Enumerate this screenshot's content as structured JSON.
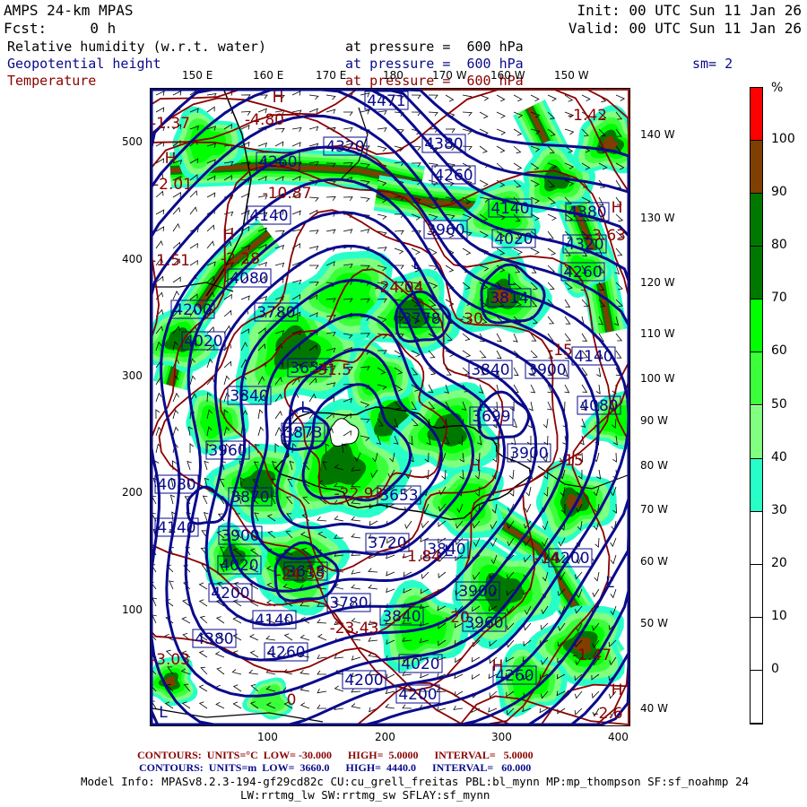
{
  "header": {
    "title": "AMPS 24-km MPAS",
    "fcst": "Fcst:     0 h",
    "init": "Init: 00 UTC Sun 11 Jan 26",
    "valid": "Valid: 00 UTC Sun 11 Jan 26",
    "fields": [
      {
        "name": "Relative humidity (w.r.t. water)",
        "level": "at pressure =  600 hPa",
        "color": "#000000"
      },
      {
        "name": "Geopotential height",
        "level": "at pressure =  600 hPa",
        "color": "#0a0a8c"
      },
      {
        "name": "Temperature",
        "level": "at pressure =  600 hPa",
        "color": "#8b0000"
      }
    ],
    "smoothing": "sm= 2"
  },
  "axes": {
    "top_lon_labels": [
      "150 E",
      "160 E",
      "170 E",
      "180",
      "170 W",
      "160 W",
      "150 W"
    ],
    "right_lon_labels": [
      "140 W",
      "130 W",
      "120 W",
      "110 W",
      "100 W",
      "90 W",
      "80 W",
      "70 W",
      "60 W",
      "50 W",
      "40 W"
    ],
    "left_ticks": [
      "500",
      "400",
      "300",
      "200",
      "100"
    ],
    "bottom_ticks": [
      "100",
      "200",
      "300",
      "400"
    ]
  },
  "colorbar": {
    "unit": "%",
    "labels": [
      "100",
      "90",
      "80",
      "70",
      "60",
      "50",
      "40",
      "30",
      "20",
      "10",
      "0"
    ],
    "colors": [
      "#ff0000",
      "#7f3f00",
      "#007800",
      "#007800",
      "#00ff00",
      "#3cff3c",
      "#80ff80",
      "#28ffc8",
      "#ffffff",
      "#ffffff",
      "#ffffff",
      "#ffffff"
    ]
  },
  "map": {
    "height_contour_color": "#0a0a8c",
    "temperature_contour_color": "#8b0000",
    "height_labels": [
      "4471",
      "4320",
      "4380",
      "4260",
      "4260",
      "4140",
      "4140",
      "3960",
      "4020",
      "4380",
      "4320",
      "4260",
      "3814",
      "3778",
      "4080",
      "4200",
      "3780",
      "4020",
      "3654",
      "3840",
      "4140",
      "3840",
      "3900",
      "4080",
      "3699",
      "3900",
      "3873",
      "3960",
      "4080",
      "3870",
      "4140",
      "3900",
      "4020",
      "3618",
      "4200",
      "4140",
      "4380",
      "4260",
      "4200",
      "3780",
      "3720",
      "3840",
      "3900",
      "3840",
      "3960",
      "4020",
      "4200",
      "4260",
      "4200",
      "3653"
    ],
    "temperature_labels": [
      "-4.80",
      "-1.37",
      "-2.01",
      "-10.87",
      "-2.28",
      "-1.51",
      "-31.5",
      "-24.04",
      "-1.42",
      "-3.63",
      "-15",
      "-30",
      "-22.93",
      "-24.35",
      "-23.43",
      "-3.03",
      "0",
      "-1.47",
      "-2.6",
      "-20",
      "-14",
      "-15",
      "-1.84"
    ],
    "high_markers": [
      "H",
      "H",
      "H",
      "H",
      "H",
      "H",
      "H"
    ],
    "low_markers": [
      "L",
      "L",
      "L",
      "L",
      "L",
      "L"
    ]
  },
  "footer": {
    "temp_contours": "CONTOURS:  UNITS=°C  LOW= -30.000      HIGH=  5.0000      INTERVAL=   5.0000",
    "height_contours": "CONTOURS:  UNITS=m  LOW=  3660.0      HIGH=  4440.0      INTERVAL=   60.000",
    "model_info_1": "Model Info: MPASv8.2.3-194-gf29cd82c CU:cu_grell_freitas PBL:bl_mynn MP:mp_thompson SF:sf_noahmp 24",
    "model_info_2": "LW:rrtmg_lw SW:rrtmg_sw SFLAY:sf_mynn"
  }
}
